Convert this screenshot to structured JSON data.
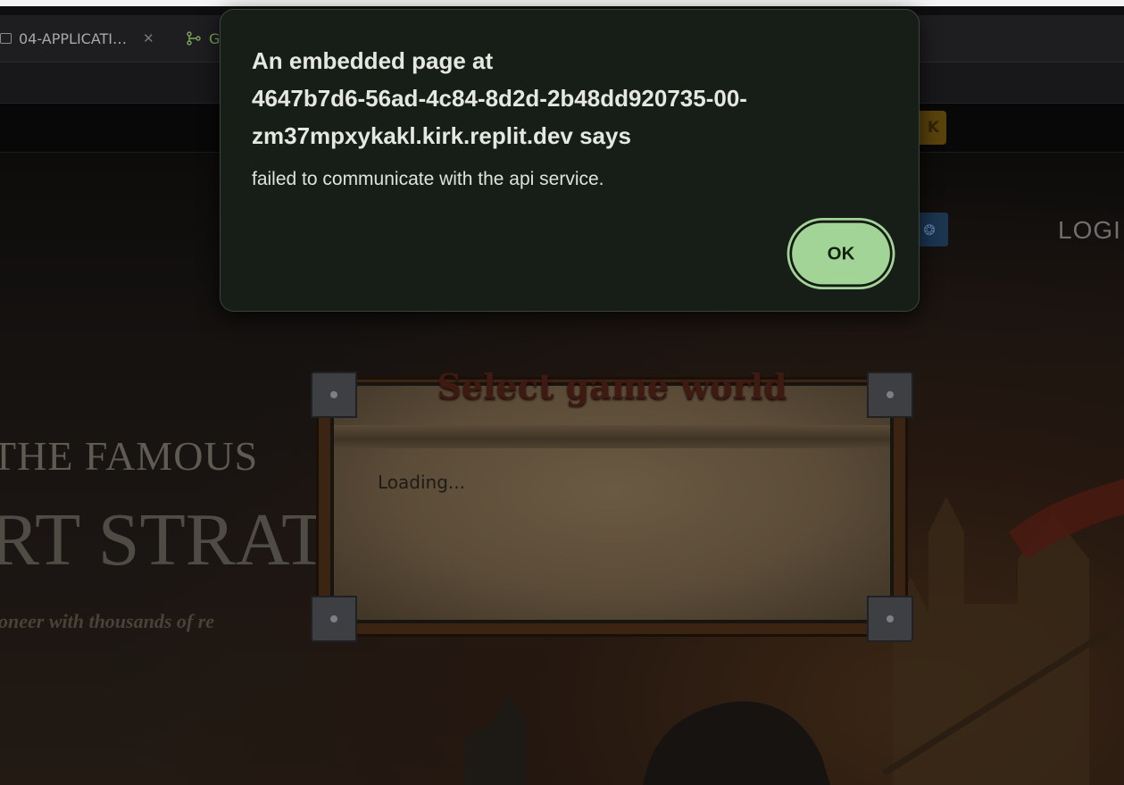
{
  "browser": {
    "tabs": [
      {
        "label": "04-APPLICATI…",
        "icon": "folder-icon"
      },
      {
        "label": "G",
        "icon": "git-branch-icon"
      }
    ]
  },
  "site": {
    "download_label": "K",
    "language_icon": "globe-icon",
    "login_label": "LOGI",
    "hero": {
      "line1": "THE FAMOUS",
      "line2": "RT STRAT",
      "tagline": "oneer with thousands of re"
    },
    "world_panel": {
      "title": "Select game world",
      "status": "Loading..."
    }
  },
  "alert_dialog": {
    "title_lines": [
      "An embedded page at",
      "4647b7d6-56ad-4c84-8d2d-2b48dd920735-00-",
      "zm37mpxykakl.kirk.replit.dev says"
    ],
    "message": "failed to communicate with the api service.",
    "ok_label": "OK",
    "colors": {
      "background": "#171d17",
      "button": "#a3d497"
    }
  }
}
